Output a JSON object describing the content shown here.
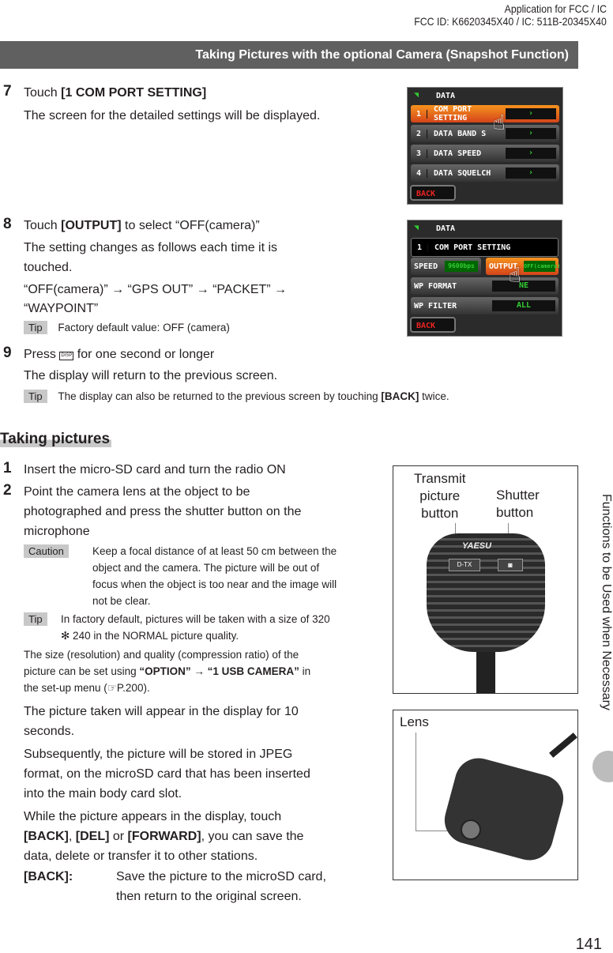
{
  "header": {
    "line1": "Application for FCC / IC",
    "line2": "FCC ID: K6620345X40 / IC: 511B-20345X40"
  },
  "section_title": "Taking Pictures with the optional Camera (Snapshot Function)",
  "side_tab": "Functions to be Used when Necessary",
  "page_number": "141",
  "steps_top": [
    {
      "num": "7",
      "pre": "Touch ",
      "bold": "[1 COM PORT SETTING]",
      "lines": [
        "The screen for the detailed settings will be displayed."
      ]
    },
    {
      "num": "8",
      "pre": "Touch ",
      "bold": "[OUTPUT]",
      "post": " to select “OFF(camera)”",
      "lines": [
        "The setting changes as follows each time it is",
        "touched.",
        "“OFF(camera)” → “GPS OUT” → “PACKET” →",
        "“WAYPOINT”"
      ],
      "tip_label": "Tip",
      "tip": "Factory default value: OFF (camera)"
    },
    {
      "num": "9",
      "pre": "Press ",
      "key": "DISP",
      "post": " for one second or longer",
      "lines": [
        "The display will return to the previous screen."
      ],
      "tip_label": "Tip",
      "tip": "The display can also be returned to the previous screen by touching ",
      "tip_bold": "[BACK]",
      "tip_post": " twice."
    }
  ],
  "screen1": {
    "title": "DATA",
    "rows": [
      {
        "n": "1",
        "label": "COM PORT SETTING"
      },
      {
        "n": "2",
        "label": "DATA BAND S"
      },
      {
        "n": "3",
        "label": "DATA SPEED"
      },
      {
        "n": "4",
        "label": "DATA SQUELCH"
      }
    ],
    "arrow": "›",
    "back": "BACK"
  },
  "screen2": {
    "title": "DATA",
    "header_n": "1",
    "header": "COM PORT SETTING",
    "speed_label": "SPEED",
    "speed_value": "9600bps",
    "output_label": "OUTPUT",
    "output_value": "OFF(camera)",
    "wp_format_label": "WP FORMAT",
    "wp_format_value": "NE",
    "wp_filter_label": "WP FILTER",
    "wp_filter_value": "ALL",
    "back": "BACK"
  },
  "taking": {
    "heading": "Taking pictures",
    "step1": {
      "num": "1",
      "text": "Insert the micro-SD card and turn the radio ON"
    },
    "step2": {
      "num": "2",
      "lines": [
        "Point the camera lens at the object to be",
        "photographed and press the shutter button on the",
        "microphone"
      ]
    },
    "caution_label": "Caution",
    "caution_lines": [
      "Keep a focal distance of at least 50 cm between the",
      "object and the camera. The picture will be out of",
      "focus when the object is too near and the image will",
      "not be clear."
    ],
    "tip_label": "Tip",
    "tip_lines": [
      "In factory default, pictures will be taken with a size of 320",
      "✻ 240 in the NORMAL picture quality."
    ],
    "note_lines": [
      "The size (resolution) and quality (compression ratio) of the",
      "picture can be set using "
    ],
    "note_bold": "“OPTION” → “1 USB CAMERA”",
    "note_post": " in",
    "note_last": "the set-up menu (☞P.200).",
    "para1": [
      "The picture taken will appear in the display for 10",
      "seconds."
    ],
    "para2": [
      "Subsequently, the picture will be stored in JPEG",
      "format, on the microSD card that has been inserted",
      "into the main body card slot."
    ],
    "para3_pre": "While the picture appears in the display, touch",
    "para3_b1": "[BACK]",
    "para3_b2": "[DEL]",
    "para3_or": " or ",
    "para3_b3": "[FORWARD]",
    "para3_post": ", you can save the",
    "para3_last": "data, delete or transfer it to other stations.",
    "back_term": "[BACK]:",
    "back_desc": [
      "Save the picture to the microSD card,",
      "then return to the original screen."
    ]
  },
  "mic1": {
    "label1": "Transmit\npicture\nbutton",
    "label2": "Shutter\nbutton",
    "brand": "YAESU",
    "key": "D-TX"
  },
  "mic2": {
    "label": "Lens"
  }
}
